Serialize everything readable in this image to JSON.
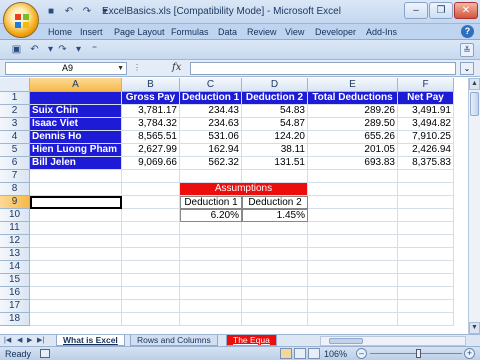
{
  "window": {
    "title": "ExcelBasics.xls  [Compatibility Mode] - Microsoft Excel"
  },
  "ribbon_tabs": [
    "Home",
    "Insert",
    "Page Layout",
    "Formulas",
    "Data",
    "Review",
    "View",
    "Developer",
    "Add-Ins"
  ],
  "formula_bar": {
    "name_box": "A9",
    "fx_label": "fx",
    "formula": ""
  },
  "columns": [
    "A",
    "B",
    "C",
    "D",
    "E",
    "F"
  ],
  "rows": [
    "1",
    "2",
    "3",
    "4",
    "5",
    "6",
    "7",
    "8",
    "9",
    "10",
    "11",
    "12",
    "13",
    "14",
    "15",
    "16",
    "17",
    "18"
  ],
  "table": {
    "headers": [
      "Gross Pay",
      "Deduction 1",
      "Deduction 2",
      "Total Deductions",
      "Net Pay"
    ],
    "rows": [
      {
        "name": "Suix Chin",
        "gross": "3,781.17",
        "d1": "234.43",
        "d2": "54.83",
        "total": "289.26",
        "net": "3,491.91"
      },
      {
        "name": "Isaac Viet",
        "gross": "3,784.32",
        "d1": "234.63",
        "d2": "54.87",
        "total": "289.50",
        "net": "3,494.82"
      },
      {
        "name": "Dennis Ho",
        "gross": "8,565.51",
        "d1": "531.06",
        "d2": "124.20",
        "total": "655.26",
        "net": "7,910.25"
      },
      {
        "name": "Hien Luong Pham",
        "gross": "2,627.99",
        "d1": "162.94",
        "d2": "38.11",
        "total": "201.05",
        "net": "2,426.94"
      },
      {
        "name": "Bill Jelen",
        "gross": "9,069.66",
        "d1": "562.32",
        "d2": "131.51",
        "total": "693.83",
        "net": "8,375.83"
      }
    ]
  },
  "assumptions": {
    "title": "Assumptions",
    "labels": [
      "Deduction 1",
      "Deduction 2"
    ],
    "values": [
      "6.20%",
      "1.45%"
    ]
  },
  "sheet_tabs": [
    "What is Excel",
    "Rows and Columns",
    "The Equa"
  ],
  "status": {
    "ready": "Ready",
    "zoom": "106%",
    "zoom_fraction": 0.53
  },
  "colors": {
    "header_blue": "#1d1bd6",
    "assumption_red": "#ee0d0d"
  }
}
